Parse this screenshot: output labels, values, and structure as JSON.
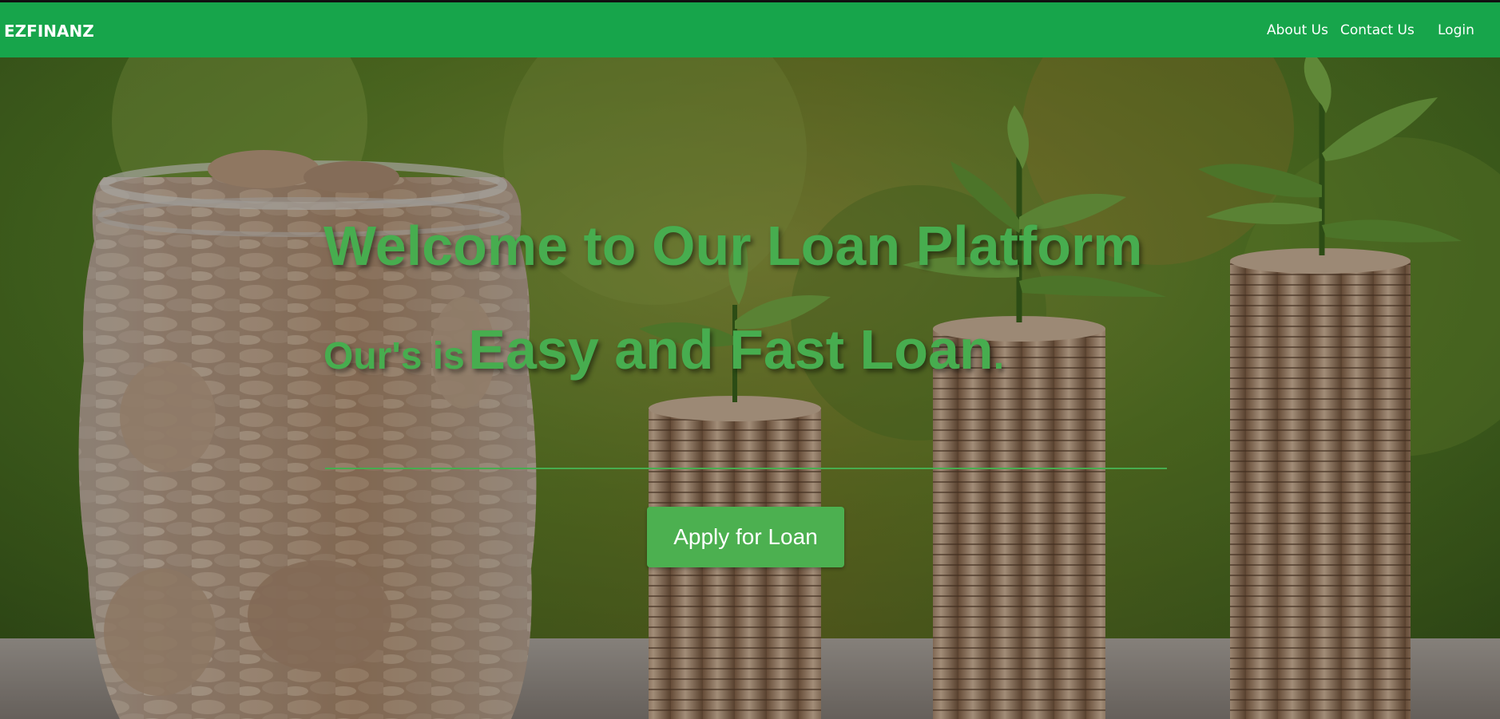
{
  "navbar": {
    "brand": "EZFINANZ",
    "links": [
      {
        "label": "About Us"
      },
      {
        "label": "Contact Us"
      },
      {
        "label": "Login"
      }
    ]
  },
  "hero": {
    "headline": "Welcome to Our Loan Platform",
    "tagline_prefix": "Our's is",
    "tagline_emphasis": "Easy and Fast Loan",
    "tagline_suffix": ".",
    "cta_label": "Apply for Loan",
    "background_image": "coin-jar-and-coin-stacks-with-plant-sprouts-photo"
  },
  "colors": {
    "navbar_bg": "#17a54b",
    "accent_text": "#47ad4f",
    "button_bg": "#4cb050"
  }
}
